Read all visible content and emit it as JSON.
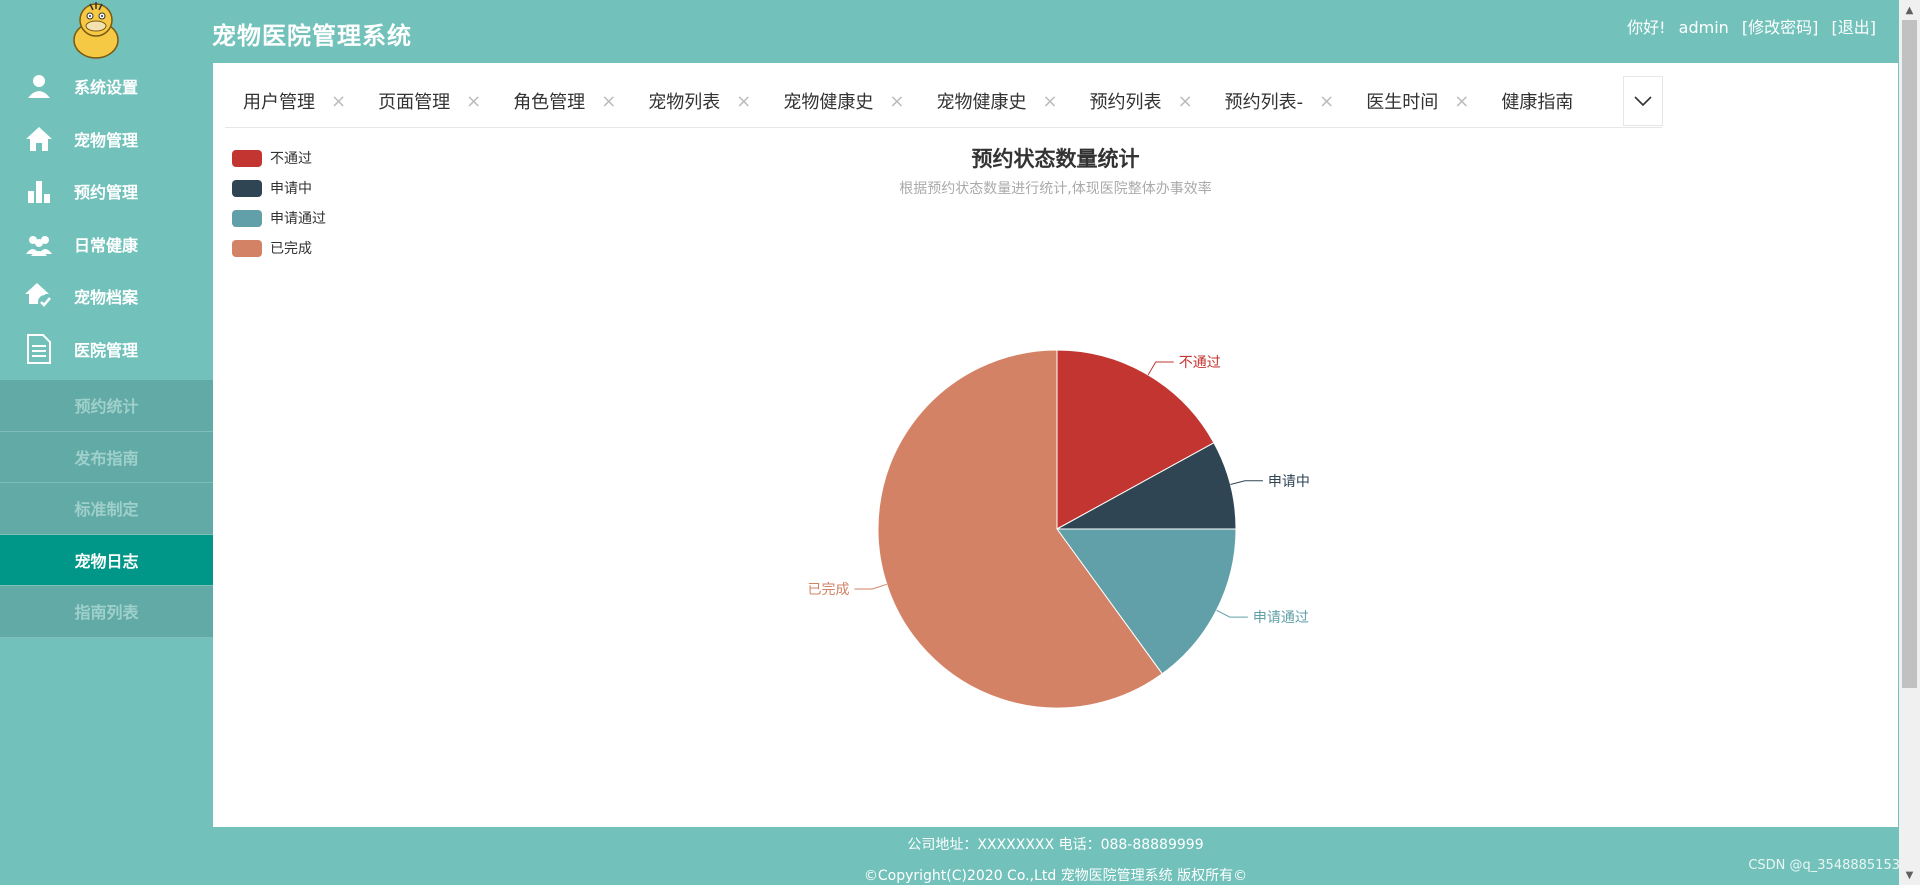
{
  "header": {
    "app_title": "宠物医院管理系统",
    "greeting": "你好!",
    "username": "admin",
    "change_password": "[修改密码]",
    "logout": "[退出]"
  },
  "sidebar": {
    "items": [
      {
        "label": "系统设置",
        "icon": "user-icon"
      },
      {
        "label": "宠物管理",
        "icon": "home-icon"
      },
      {
        "label": "预约管理",
        "icon": "bar-chart-icon"
      },
      {
        "label": "日常健康",
        "icon": "group-icon"
      },
      {
        "label": "宠物档案",
        "icon": "home-check-icon"
      },
      {
        "label": "医院管理",
        "icon": "document-icon"
      }
    ],
    "submenu": [
      {
        "label": "预约统计",
        "active": false
      },
      {
        "label": "发布指南",
        "active": false
      },
      {
        "label": "标准制定",
        "active": false
      },
      {
        "label": "宠物日志",
        "active": true
      },
      {
        "label": "指南列表",
        "active": false
      }
    ]
  },
  "tabs": [
    {
      "label": "用户管理"
    },
    {
      "label": "页面管理"
    },
    {
      "label": "角色管理"
    },
    {
      "label": "宠物列表"
    },
    {
      "label": "宠物健康史"
    },
    {
      "label": "宠物健康史"
    },
    {
      "label": "预约列表"
    },
    {
      "label": "预约列表-"
    },
    {
      "label": "医生时间"
    },
    {
      "label": "健康指南"
    }
  ],
  "tab_close_symbol": "×",
  "chart_data": {
    "type": "pie",
    "title": "预约状态数量统计",
    "subtitle": "根据预约状态数量进行统计,体现医院整体办事效率",
    "legend_position": "top-left",
    "slices": [
      {
        "name": "不通过",
        "value": 17,
        "color": "#c23531"
      },
      {
        "name": "申请中",
        "value": 8,
        "color": "#2f4554"
      },
      {
        "name": "申请通过",
        "value": 15,
        "color": "#61a0a8"
      },
      {
        "name": "已完成",
        "value": 60,
        "color": "#d48265"
      }
    ]
  },
  "footer": {
    "address": "公司地址：XXXXXXXX 电话：088-88889999",
    "copyright": "©Copyright(C)2020 Co.,Ltd 宠物医院管理系统 版权所有©"
  },
  "watermark": "CSDN @q_3548885153"
}
